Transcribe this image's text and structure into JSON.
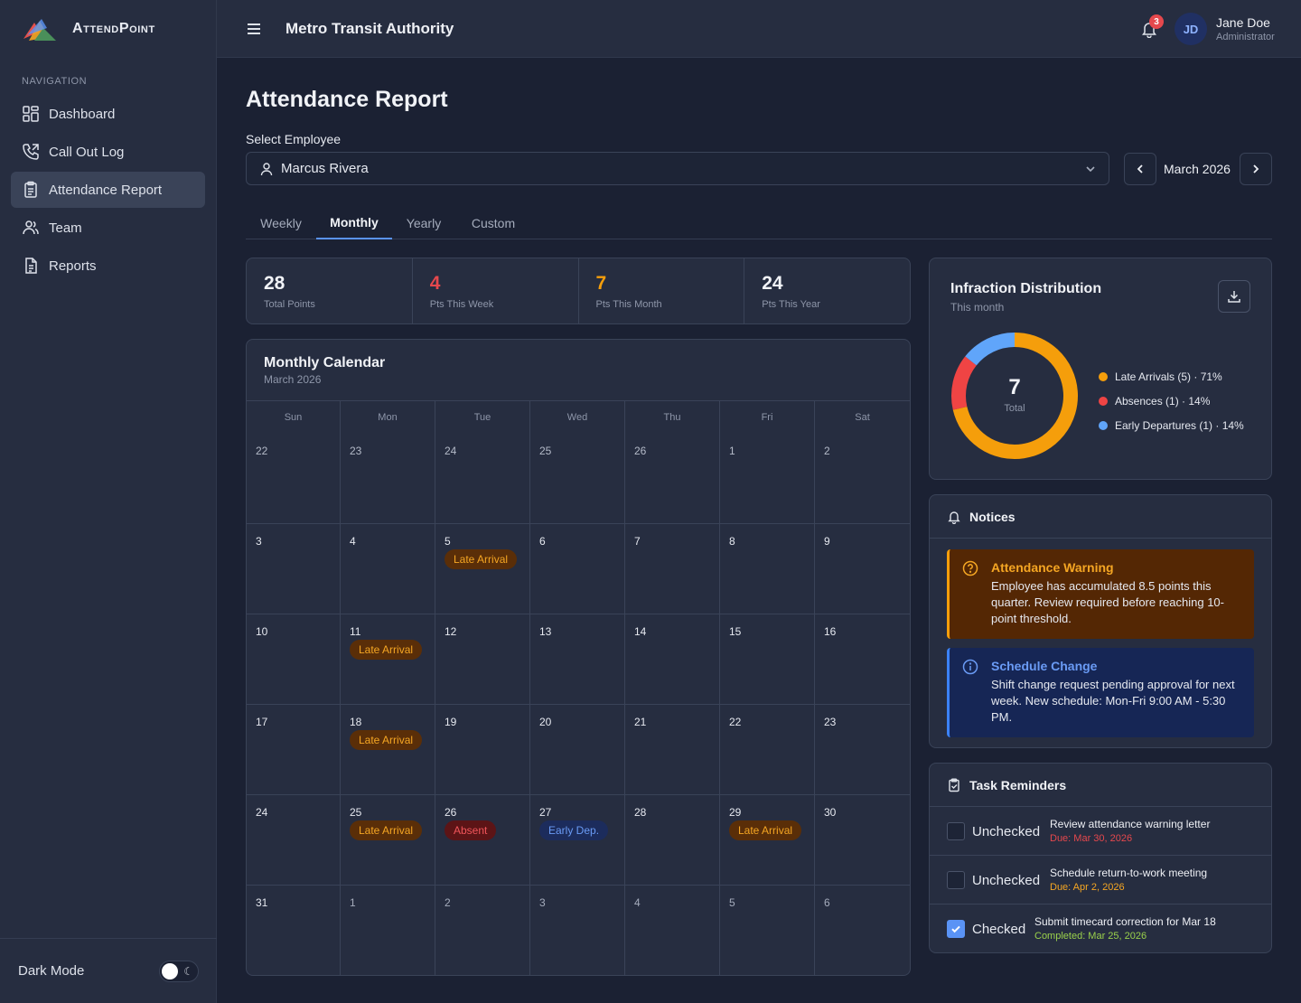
{
  "brand": {
    "name": "AttendPoint"
  },
  "topbar": {
    "org_name": "Metro Transit Authority",
    "notification_count": "3",
    "user_initials": "JD",
    "user_name": "Jane Doe",
    "user_role": "Administrator"
  },
  "sidebar": {
    "heading": "NAVIGATION",
    "items": [
      {
        "label": "Dashboard",
        "icon": "dashboard-icon"
      },
      {
        "label": "Call Out Log",
        "icon": "phone-icon"
      },
      {
        "label": "Attendance Report",
        "icon": "clipboard-icon",
        "active": true
      },
      {
        "label": "Team",
        "icon": "team-icon"
      },
      {
        "label": "Reports",
        "icon": "document-icon"
      }
    ],
    "dark_mode_label": "Dark Mode",
    "dark_mode_on": false
  },
  "page": {
    "title": "Attendance Report",
    "select_label": "Select Employee",
    "selected_employee": "Marcus Rivera",
    "month": "March 2026"
  },
  "tabs": [
    {
      "label": "Weekly"
    },
    {
      "label": "Monthly",
      "active": true
    },
    {
      "label": "Yearly"
    },
    {
      "label": "Custom"
    }
  ],
  "stats": [
    {
      "value": "28",
      "label": "Total Points",
      "color": "#f1f3f7"
    },
    {
      "value": "4",
      "label": "Pts This Week",
      "color": "#e5484d"
    },
    {
      "value": "7",
      "label": "Pts This Month",
      "color": "#f59e0b"
    },
    {
      "value": "24",
      "label": "Pts This Year",
      "color": "#f1f3f7"
    }
  ],
  "calendar": {
    "title": "Monthly Calendar",
    "subtitle": "March 2026",
    "weekdays": [
      "Sun",
      "Mon",
      "Tue",
      "Wed",
      "Thu",
      "Fri",
      "Sat"
    ],
    "days": [
      {
        "n": "22"
      },
      {
        "n": "23"
      },
      {
        "n": "24"
      },
      {
        "n": "25"
      },
      {
        "n": "26"
      },
      {
        "n": "1"
      },
      {
        "n": "2"
      },
      {
        "n": "3"
      },
      {
        "n": "4"
      },
      {
        "n": "5",
        "event": "Late Arrival",
        "kind": "late"
      },
      {
        "n": "6"
      },
      {
        "n": "7"
      },
      {
        "n": "8"
      },
      {
        "n": "9"
      },
      {
        "n": "10"
      },
      {
        "n": "11",
        "event": "Late Arrival",
        "kind": "late"
      },
      {
        "n": "12"
      },
      {
        "n": "13"
      },
      {
        "n": "14"
      },
      {
        "n": "15"
      },
      {
        "n": "16"
      },
      {
        "n": "17"
      },
      {
        "n": "18",
        "event": "Late Arrival",
        "kind": "late"
      },
      {
        "n": "19"
      },
      {
        "n": "20"
      },
      {
        "n": "21"
      },
      {
        "n": "22"
      },
      {
        "n": "23"
      },
      {
        "n": "24"
      },
      {
        "n": "25",
        "event": "Late Arrival",
        "kind": "late"
      },
      {
        "n": "26",
        "event": "Absent",
        "kind": "absent"
      },
      {
        "n": "27",
        "event": "Early Dep.",
        "kind": "early"
      },
      {
        "n": "28"
      },
      {
        "n": "29",
        "event": "Late Arrival",
        "kind": "late"
      },
      {
        "n": "30"
      },
      {
        "n": "31"
      },
      {
        "n": "1",
        "muted": true
      },
      {
        "n": "2",
        "muted": true
      },
      {
        "n": "3",
        "muted": true
      },
      {
        "n": "4",
        "muted": true
      },
      {
        "n": "5",
        "muted": true
      },
      {
        "n": "6",
        "muted": true
      }
    ]
  },
  "distribution": {
    "title": "Infraction Distribution",
    "subtitle": "This month",
    "total": "7",
    "total_label": "Total",
    "slices": [
      {
        "label": "Late Arrivals (5) · 71%",
        "value": 5,
        "color": "#f59e0b"
      },
      {
        "label": "Absences (1) · 14%",
        "value": 1,
        "color": "#ef4444"
      },
      {
        "label": "Early Departures (1) · 14%",
        "value": 1,
        "color": "#60a5fa"
      }
    ]
  },
  "notices": {
    "title": "Notices",
    "items": [
      {
        "title": "Attendance Warning",
        "body": "Employee has accumulated 8.5 points this quarter. Review required before reaching 10-point threshold."
      },
      {
        "title": "Schedule Change",
        "body": "Shift change request pending approval for next week. New schedule: Mon-Fri 9:00 AM - 5:30 PM."
      }
    ]
  },
  "tasks": {
    "title": "Task Reminders",
    "items": [
      {
        "state": "Unchecked",
        "checked": false,
        "text": "Review attendance warning letter",
        "due": "Due: Mar 30, 2026",
        "due_color": "#e5484d"
      },
      {
        "state": "Unchecked",
        "checked": false,
        "text": "Schedule return-to-work meeting",
        "due": "Due: Apr 2, 2026",
        "due_color": "#f5a623"
      },
      {
        "state": "Checked",
        "checked": true,
        "text": "Submit timecard correction for Mar 18",
        "due": "Completed: Mar 25, 2026",
        "due_color": "#9ad14b"
      }
    ]
  }
}
